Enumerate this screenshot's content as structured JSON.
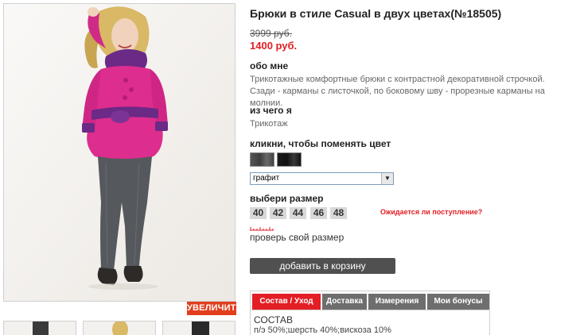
{
  "product": {
    "title": "Брюки в стиле Casual в двух цветах(№18505)",
    "old_price": "3999 руб.",
    "new_price": "1400 руб."
  },
  "about": {
    "heading": "обо мне",
    "text": "Трикотажные комфортные брюки с контрастной декоративной строчкой. Сзади - карманы с листочкой, по боковому шву - прорезные карманы на молнии."
  },
  "material": {
    "heading": "из чего я",
    "text": "Трикотаж"
  },
  "color": {
    "heading": "кликни, чтобы поменять цвет",
    "swatches": [
      "graphite-swatch",
      "black-swatch"
    ],
    "selected": "графит"
  },
  "size": {
    "heading": "выбери размер",
    "options": [
      "40",
      "42",
      "44",
      "46",
      "48"
    ],
    "awaiting_link": "Ожидается ли поступление?",
    "check_link": "проверь свой размер"
  },
  "actions": {
    "zoom_label": "УВЕЛИЧИТЬ",
    "add_to_cart": "добавить в корзину"
  },
  "tabs": {
    "items": [
      {
        "label": "Состав / Уход",
        "active": true
      },
      {
        "label": "Доставка",
        "active": false
      },
      {
        "label": "Измерения",
        "active": false
      },
      {
        "label": "Мои бонусы",
        "active": false
      }
    ],
    "composition_heading": "СОСТАВ",
    "composition_text": "п/э 50%;шерсть 40%;вискоза 10%"
  },
  "colors": {
    "accent": "#e31e24",
    "button": "#505050",
    "tab_inactive": "#6e6e6e"
  }
}
